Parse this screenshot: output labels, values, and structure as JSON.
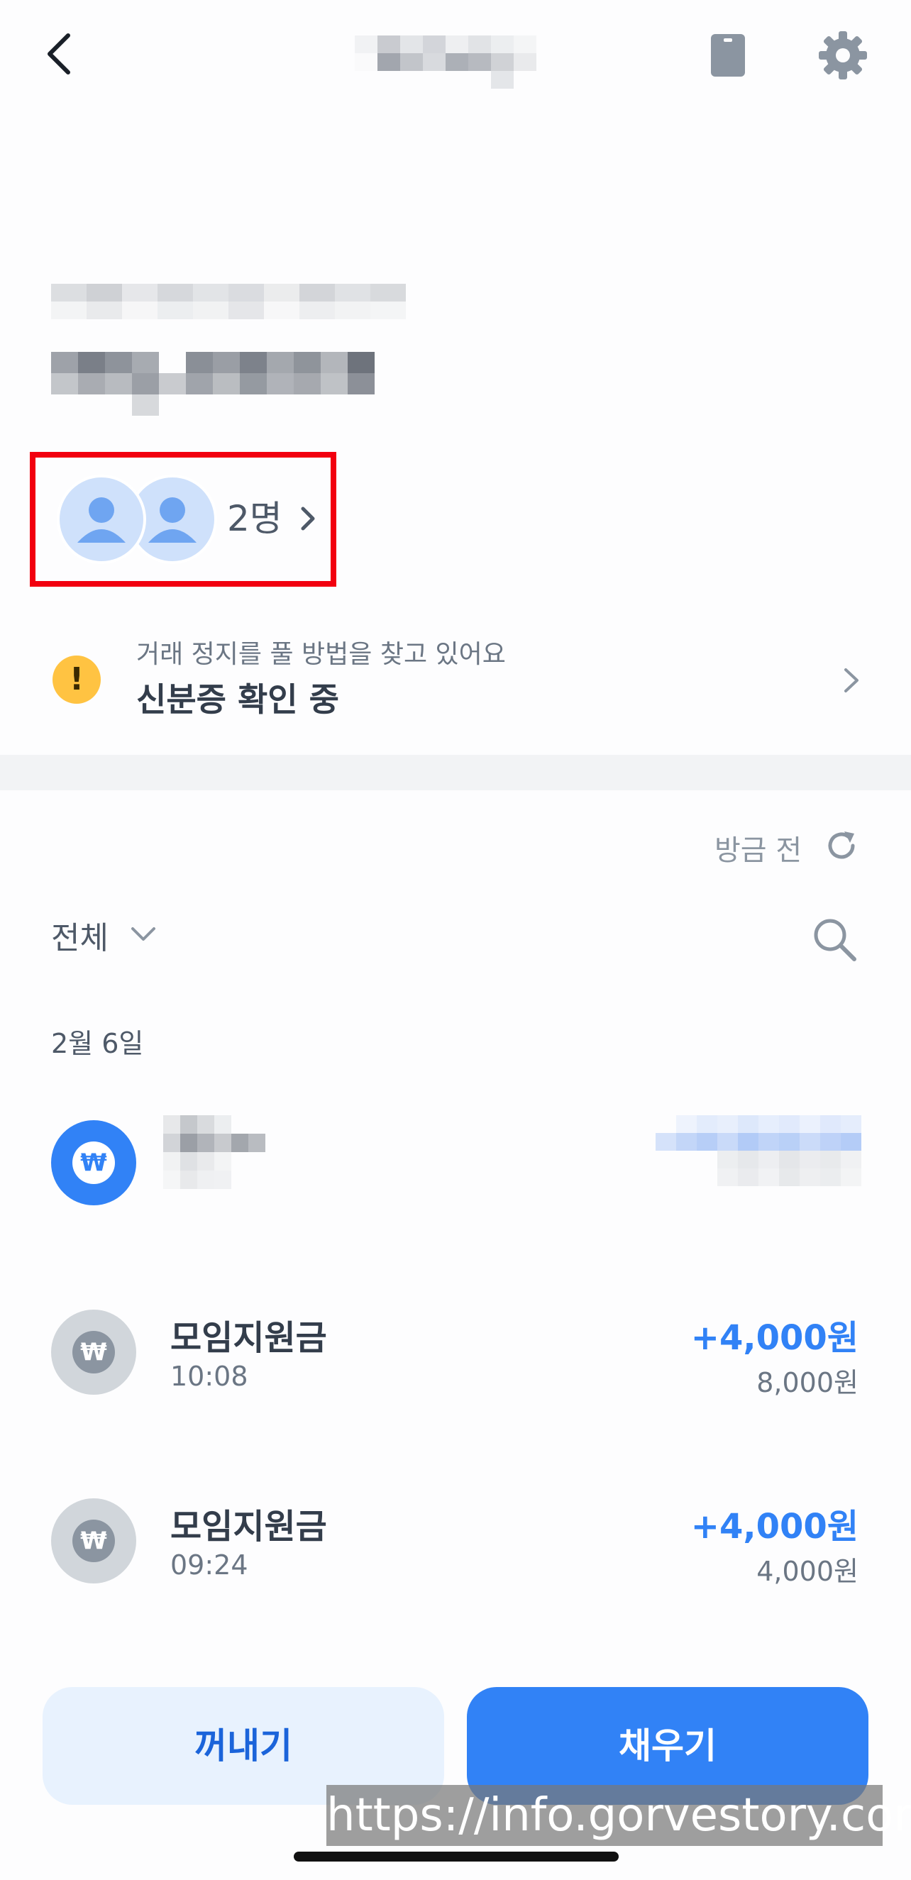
{
  "nav": {
    "back_icon": "chevron-left-icon",
    "card_icon": "card-icon",
    "settings_icon": "gear-icon"
  },
  "members": {
    "count_label": "2명"
  },
  "notice": {
    "icon": "exclamation-icon",
    "icon_glyph": "!",
    "subtitle": "거래 정지를 풀 방법을 찾고 있어요",
    "title": "신분증 확인 중"
  },
  "refresh": {
    "label": "방금 전",
    "icon": "refresh-icon"
  },
  "filter": {
    "label": "전체",
    "icon": "chevron-down-icon",
    "search_icon": "search-icon"
  },
  "transactions": {
    "date": "2월 6일",
    "coin_glyph": "₩",
    "items": [
      {
        "title": "모임지원금",
        "time": "10:08",
        "amount": "+4,000원",
        "balance": "8,000원"
      },
      {
        "title": "모임지원금",
        "time": "09:24",
        "amount": "+4,000원",
        "balance": "4,000원"
      }
    ]
  },
  "actions": {
    "withdraw": "꺼내기",
    "fill": "채우기"
  },
  "watermark": "https://info.gorvestory.com",
  "colors": {
    "accent": "#3182f6",
    "warning": "#ffc342",
    "highlight_box": "#f2000f",
    "avatar": "#cfe1fb"
  }
}
